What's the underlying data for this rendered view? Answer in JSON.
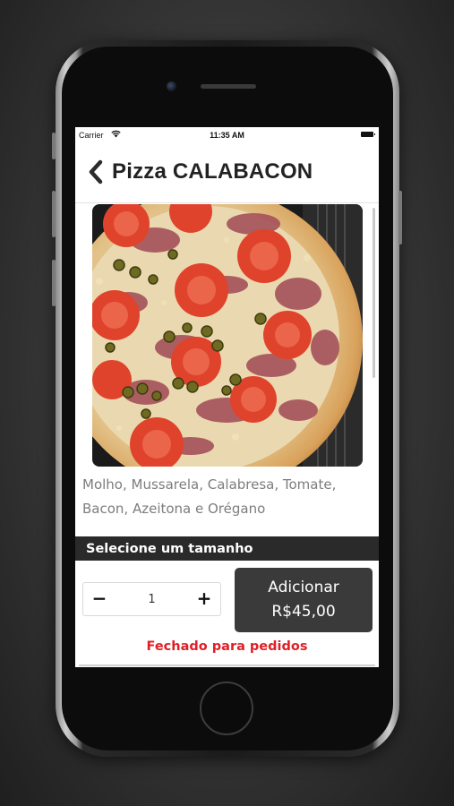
{
  "status_bar": {
    "carrier": "Carrier",
    "time": "11:35 AM"
  },
  "navbar": {
    "title": "Pizza CALABACON"
  },
  "product": {
    "description": "Molho, Mussarela, Calabresa, Tomate, Bacon, Azeitona e Orégano"
  },
  "size_section": {
    "title": "Selecione um tamanho"
  },
  "order": {
    "minus_label": "−",
    "quantity": "1",
    "plus_label": "+",
    "add_label": "Adicionar",
    "price": "R$45,00",
    "closed_message": "Fechado para pedidos"
  },
  "colors": {
    "accent_dark": "#3a3a3a",
    "closed_red": "#e01f26"
  }
}
